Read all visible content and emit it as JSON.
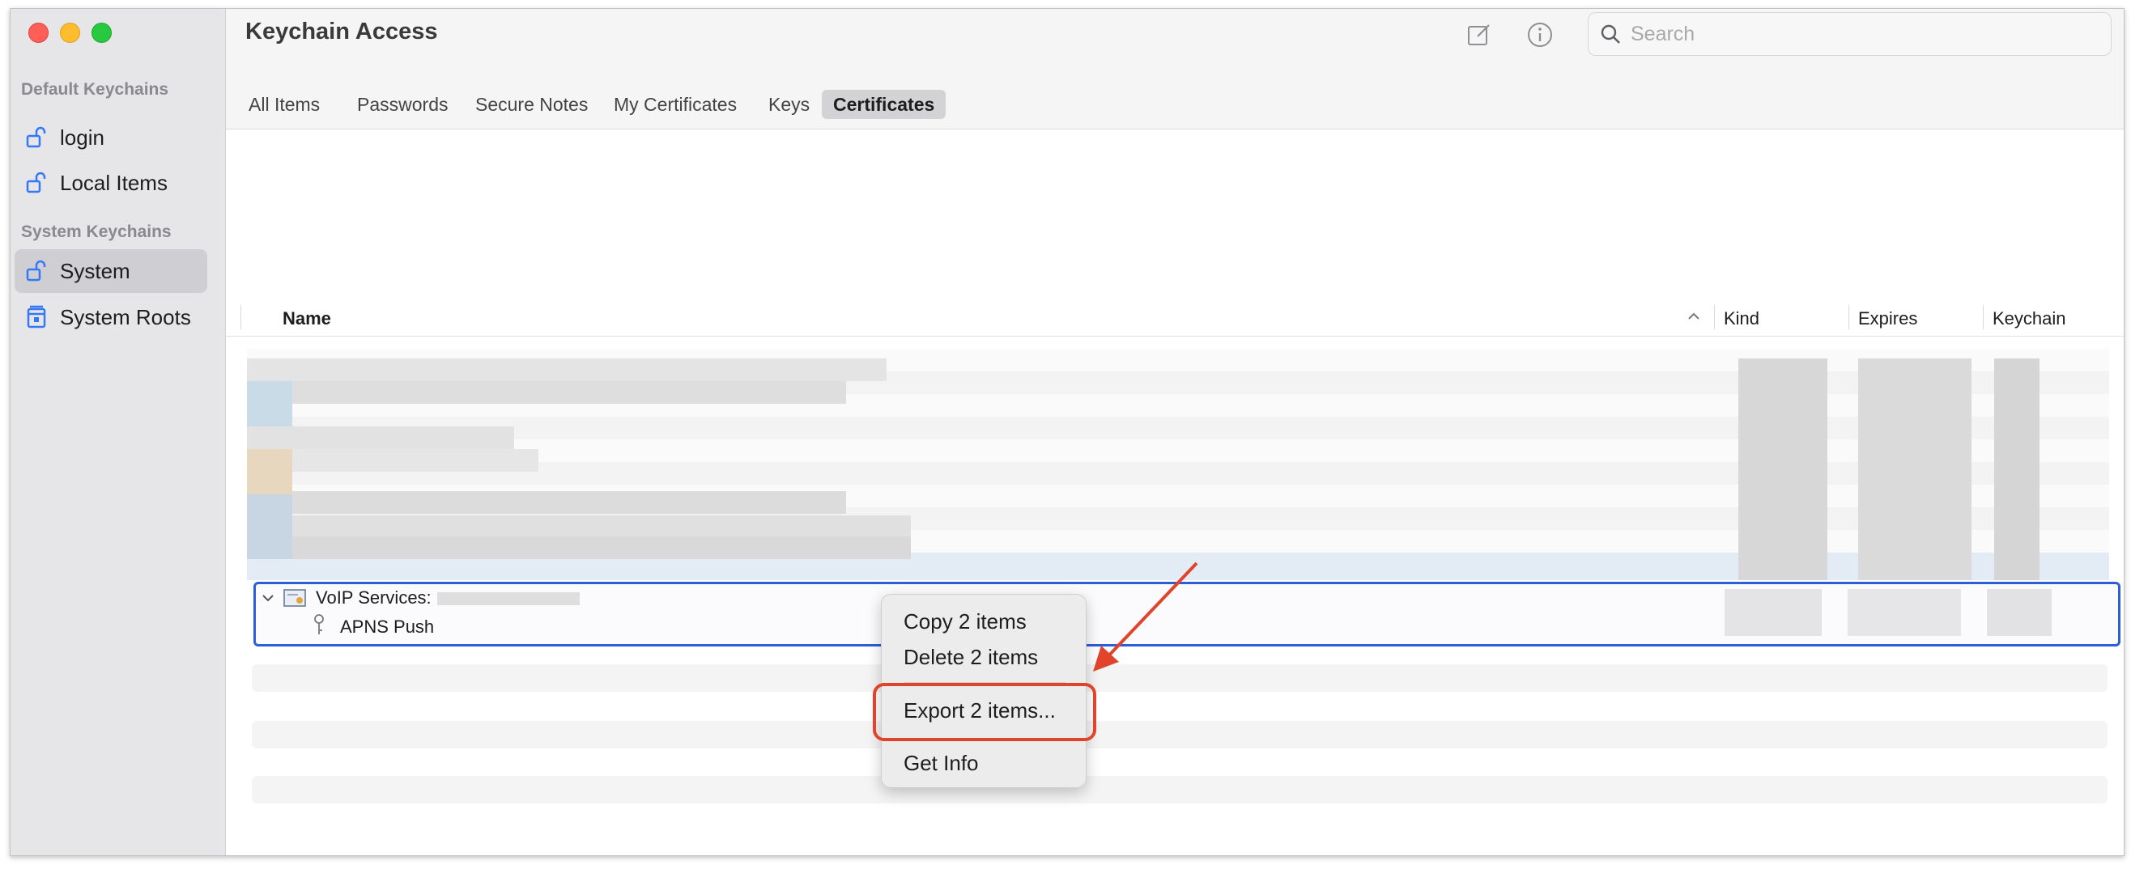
{
  "sidebar": {
    "default_header": "Default Keychains",
    "system_header": "System Keychains",
    "items": [
      {
        "label": "login",
        "icon": "unlocked-padlock-icon"
      },
      {
        "label": "Local Items",
        "icon": "unlocked-padlock-icon"
      },
      {
        "label": "System",
        "icon": "unlocked-padlock-icon"
      },
      {
        "label": "System Roots",
        "icon": "locked-cabinet-icon"
      }
    ],
    "selected": "System"
  },
  "toolbar": {
    "title": "Keychain Access",
    "search_placeholder": "Search",
    "icons": [
      "compose-icon",
      "info-icon",
      "search-icon"
    ]
  },
  "tabs": [
    {
      "label": "All Items"
    },
    {
      "label": "Passwords"
    },
    {
      "label": "Secure Notes"
    },
    {
      "label": "My Certificates"
    },
    {
      "label": "Keys"
    },
    {
      "label": "Certificates"
    }
  ],
  "active_tab": "Certificates",
  "columns": {
    "name": "Name",
    "kind": "Kind",
    "expires": "Expires",
    "keychain": "Keychain"
  },
  "rows": {
    "parent": "VoIP Services:",
    "child": "APNS Push"
  },
  "context_menu": {
    "items": [
      {
        "label": "Copy 2 items"
      },
      {
        "label": "Delete 2 items"
      },
      {
        "label": "Export 2 items..."
      },
      {
        "label": "Get Info"
      }
    ],
    "highlighted": "Export 2 items..."
  },
  "colors": {
    "accent": "#2c5fd6",
    "annotation": "#e0442b",
    "sidebar_bg": "#e6e5e8"
  }
}
